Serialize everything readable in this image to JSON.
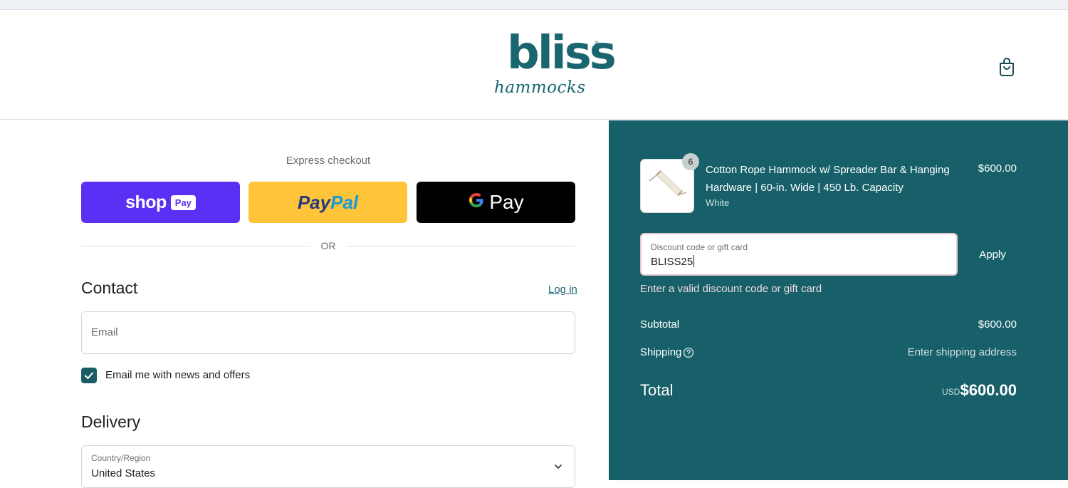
{
  "header": {
    "logo_main": "bliss",
    "logo_sub": "hammocks"
  },
  "express": {
    "label": "Express checkout",
    "shop_label": "shop",
    "shop_pill": "Pay",
    "paypal_part1": "Pay",
    "paypal_part2": "Pal",
    "gpay_g": "G",
    "gpay_label": "Pay",
    "or_label": "OR"
  },
  "contact": {
    "heading": "Contact",
    "login_link": "Log in",
    "email_placeholder": "Email",
    "newsletter_label": "Email me with news and offers",
    "newsletter_checked": true
  },
  "delivery": {
    "heading": "Delivery",
    "country_label": "Country/Region",
    "country_value": "United States"
  },
  "summary": {
    "quantity": "6",
    "product_title": "Cotton Rope Hammock w/ Spreader Bar & Hanging Hardware | 60-in. Wide | 450 Lb. Capacity",
    "product_variant": "White",
    "product_price": "$600.00",
    "discount_label": "Discount code or gift card",
    "discount_value": "BLISS25",
    "apply_label": "Apply",
    "error_message": "Enter a valid discount code or gift card",
    "subtotal_label": "Subtotal",
    "subtotal_value": "$600.00",
    "shipping_label": "Shipping",
    "shipping_value": "Enter shipping address",
    "total_label": "Total",
    "currency": "USD",
    "total_value": "$600.00"
  },
  "colors": {
    "brand_teal": "#17606a",
    "shop_purple": "#5a31f4",
    "paypal_yellow": "#ffc439"
  }
}
